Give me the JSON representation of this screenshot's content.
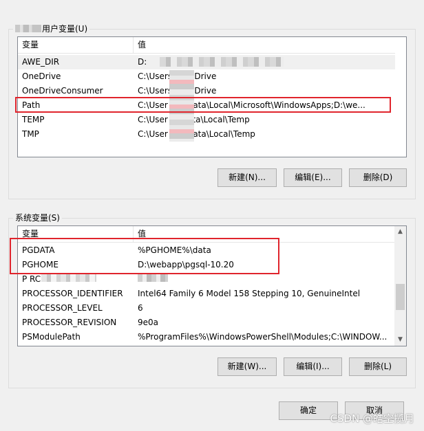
{
  "user_vars": {
    "title": "用户变量(U)",
    "col_var": "变量",
    "col_val": "值",
    "rows": [
      {
        "name": "AWE_DIR",
        "value": "D:"
      },
      {
        "name": "OneDrive",
        "value": "C:\\Users\\        OneDrive"
      },
      {
        "name": "OneDriveConsumer",
        "value": "C:\\Users\\        OneDrive"
      },
      {
        "name": "Path",
        "value": "C:\\User        AppData\\Local\\Microsoft\\WindowsApps;D:\\we..."
      },
      {
        "name": "TEMP",
        "value": "C:\\User        ppData\\Local\\Temp"
      },
      {
        "name": "TMP",
        "value": "C:\\User        AppData\\Local\\Temp"
      }
    ],
    "btn_new": "新建(N)...",
    "btn_edit": "编辑(E)...",
    "btn_delete": "删除(D)"
  },
  "sys_vars": {
    "title": "系统变量(S)",
    "col_var": "变量",
    "col_val": "值",
    "rows": [
      {
        "name": "PGDATA",
        "value": "%PGHOME%\\data"
      },
      {
        "name": "PGHOME",
        "value": "D:\\webapp\\pgsql-10.20"
      },
      {
        "name": "P           RCHITECT",
        "value": ""
      },
      {
        "name": "PROCESSOR_IDENTIFIER",
        "value": "Intel64 Family 6 Model 158 Stepping 10, GenuineIntel"
      },
      {
        "name": "PROCESSOR_LEVEL",
        "value": "6"
      },
      {
        "name": "PROCESSOR_REVISION",
        "value": "9e0a"
      },
      {
        "name": "PSModulePath",
        "value": "%ProgramFiles%\\WindowsPowerShell\\Modules;C:\\WINDOW..."
      }
    ],
    "btn_new": "新建(W)...",
    "btn_edit": "编辑(I)...",
    "btn_delete": "删除(L)"
  },
  "dialog": {
    "ok": "确定",
    "cancel": "取消"
  },
  "watermark": "CSDN @皓空揽月",
  "colors": {
    "highlight_box": "#e0242c",
    "button_face": "#e1e1e1",
    "window_bg": "#f0f0f0"
  }
}
